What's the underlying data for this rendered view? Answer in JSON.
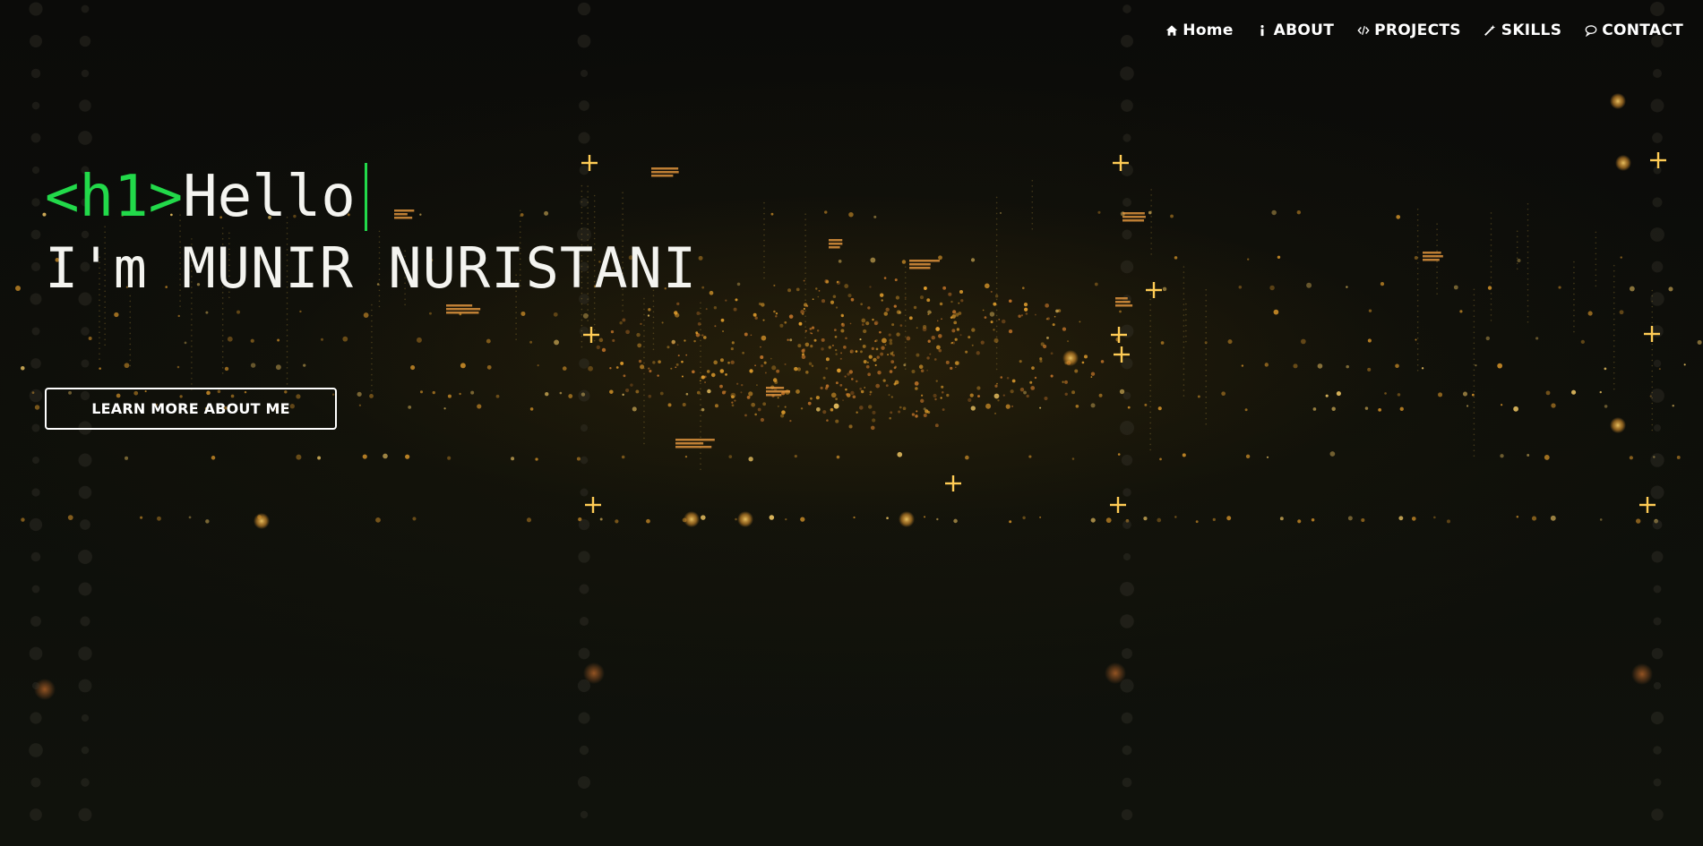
{
  "nav": {
    "items": [
      {
        "label": "Home",
        "icon": "home-icon"
      },
      {
        "label": "ABOUT",
        "icon": "info-icon"
      },
      {
        "label": "PROJECTS",
        "icon": "code-icon"
      },
      {
        "label": "SKILLS",
        "icon": "magic-wand-icon"
      },
      {
        "label": "CONTACT",
        "icon": "chat-icon"
      }
    ]
  },
  "hero": {
    "tag": "<h1>",
    "greeting": "Hello",
    "name_line": "I'm MUNIR NURISTANI",
    "cta_label": "LEARN MORE ABOUT ME"
  },
  "colors": {
    "accent": "#22d94a",
    "text": "#ffffff",
    "glow": "#f0a830"
  }
}
